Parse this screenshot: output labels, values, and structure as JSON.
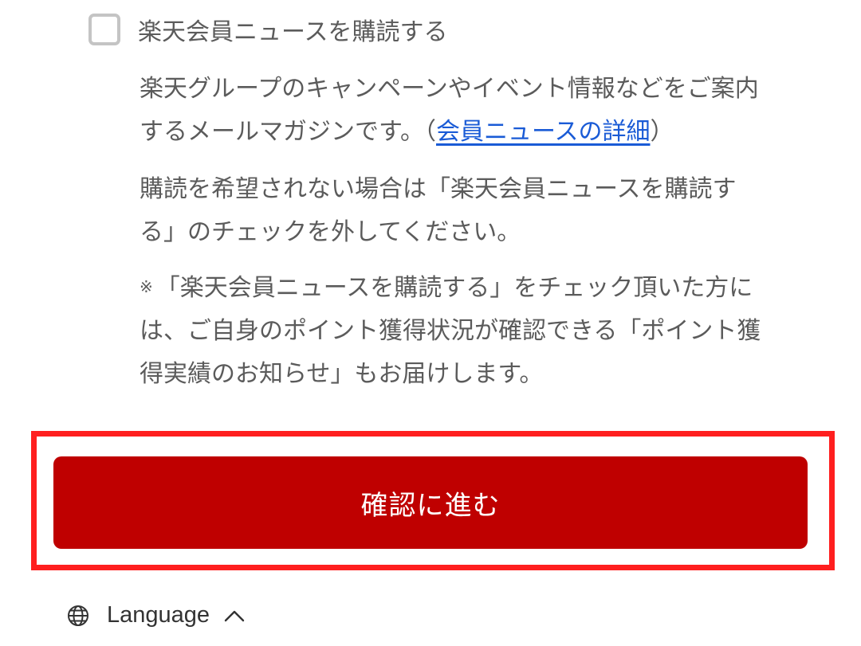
{
  "subscription": {
    "checkbox_label": "楽天会員ニュースを購読する",
    "checked": false
  },
  "description": {
    "p1_line1": "楽天グループのキャンペーンやイベント情報などをご案内",
    "p1_line2_prefix": "するメールマガジンです。（",
    "p1_link": "会員ニュースの詳細",
    "p1_line2_suffix": "）",
    "p2_line1": "購読を希望されない場合は「楽天会員ニュースを購読す",
    "p2_line2": "る」のチェックを外してください。",
    "p3_mark": "※",
    "p3_line1": "「楽天会員ニュースを購読する」をチェック頂いた方に",
    "p3_line2": "は、ご自身のポイント獲得状況が確認できる「ポイント獲",
    "p3_line3": "得実績のお知らせ」もお届けします。"
  },
  "actions": {
    "confirm_label": "確認に進む"
  },
  "footer": {
    "language_label": "Language"
  },
  "colors": {
    "primary": "#bf0000",
    "highlight": "#ff1f1f",
    "link": "#1a5bd6",
    "text": "#5b5b5b"
  },
  "icons": {
    "language": "globe-icon",
    "language_toggle": "chevron-up-icon"
  }
}
